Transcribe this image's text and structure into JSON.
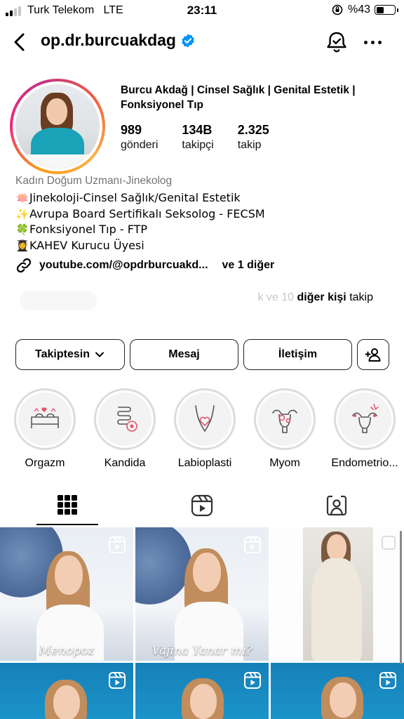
{
  "status_bar": {
    "carrier": "Turk Telekom",
    "network": "LTE",
    "time": "23:11",
    "battery": "%43",
    "battery_level": 0.43
  },
  "header": {
    "username": "op.dr.burcuakdag",
    "verified": true
  },
  "profile": {
    "full_name": "Burcu Akdağ | Cinsel Sağlık | Genital Estetik | Fonksiyonel Tıp",
    "stats": [
      {
        "value": "989",
        "label": "gönderi"
      },
      {
        "value": "134B",
        "label": "takipçi"
      },
      {
        "value": "2.325",
        "label": "takip"
      }
    ],
    "category": "Kadın Doğum Uzmanı-Jinekolog",
    "bio_lines": [
      {
        "emoji": "🪷",
        "text": "Jinekoloji-Cinsel Sağlık/Genital Estetik"
      },
      {
        "emoji": "✨",
        "text": "Avrupa Board Sertifikalı Seksolog - FECSM"
      },
      {
        "emoji": "🍀",
        "text": "Fonksiyonel Tıp - FTP"
      },
      {
        "emoji": "👩‍🎓",
        "text": "KAHEV Kurucu Üyesi"
      }
    ],
    "link": "youtube.com/@opdrburcuakd...",
    "link_more": "ve 1 diğer",
    "followed_by": {
      "faded": "k ve 10",
      "bold": "diğer kişi",
      "tail": "takip"
    }
  },
  "actions": {
    "follow_label": "Takiptesin",
    "message_label": "Mesaj",
    "contact_label": "İletişim"
  },
  "highlights": [
    {
      "label": "Orgazm",
      "icon": "bed-hearts-icon"
    },
    {
      "label": "Kandida",
      "icon": "intestine-icon"
    },
    {
      "label": "Labioplasti",
      "icon": "pelvis-heart-icon"
    },
    {
      "label": "Myom",
      "icon": "uterus-icon"
    },
    {
      "label": "Endometrio...",
      "icon": "uterus-alert-icon"
    }
  ],
  "tabs": [
    {
      "name": "posts-grid",
      "icon": "grid-icon",
      "active": true
    },
    {
      "name": "reels",
      "icon": "reels-icon",
      "active": false
    },
    {
      "name": "tagged",
      "icon": "tagged-user-icon",
      "active": false
    }
  ],
  "posts": [
    {
      "caption": "Menopoz",
      "type": "reel"
    },
    {
      "caption": "Vajina Yanar mı?",
      "type": "reel"
    },
    {
      "caption": "",
      "type": "photo"
    },
    {
      "caption": "",
      "type": "reel"
    },
    {
      "caption": "",
      "type": "reel"
    },
    {
      "caption": "",
      "type": "reel"
    }
  ],
  "colors": {
    "verified_blue": "#0095f6",
    "text_secondary": "#737373",
    "highlight_accent": "#e2556a"
  }
}
